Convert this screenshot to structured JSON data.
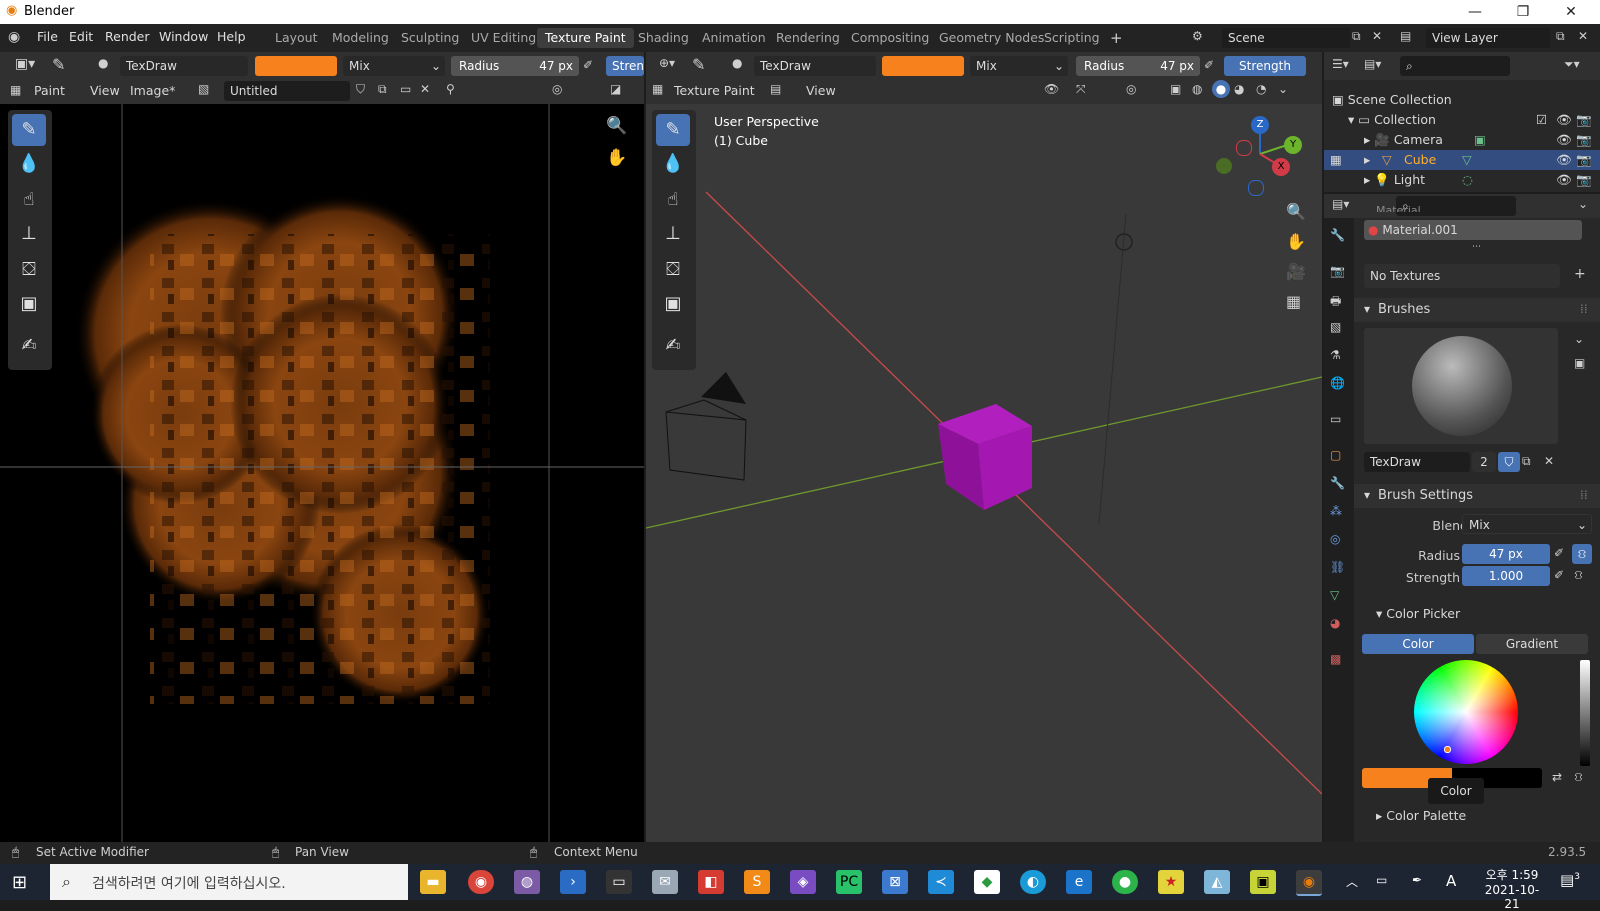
{
  "window": {
    "title": "Blender",
    "minimize": "—",
    "maximize": "❐",
    "close": "✕"
  },
  "menu": [
    "File",
    "Edit",
    "Render",
    "Window",
    "Help"
  ],
  "workspaces": [
    "Layout",
    "Modeling",
    "Sculpting",
    "UV Editing",
    "Texture Paint",
    "Shading",
    "Animation",
    "Rendering",
    "Compositing",
    "Geometry Nodes",
    "Scripting"
  ],
  "active_workspace": "Texture Paint",
  "scene": "Scene",
  "view_layer": "View Layer",
  "image_editor": {
    "brush_name": "TexDraw",
    "blend": "Mix",
    "radius_label": "Radius",
    "radius_value": "47 px",
    "strength_label": "Stren",
    "mode": "Paint",
    "view_menu": "View",
    "image_menu": "Image*",
    "image_name": "Untitled"
  },
  "viewport": {
    "brush_name": "TexDraw",
    "blend": "Mix",
    "radius_label": "Radius",
    "radius_value": "47 px",
    "strength_label": "Strength",
    "mode": "Texture Paint",
    "view_menu": "View",
    "overlay_title": "User Perspective",
    "overlay_object": "(1) Cube",
    "gizmo_z": "Z",
    "gizmo_y": "Y",
    "gizmo_x": "X"
  },
  "outliner": {
    "scene_collection": "Scene Collection",
    "collection": "Collection",
    "items": [
      "Camera",
      "Cube",
      "Light"
    ],
    "selected": "Cube"
  },
  "properties": {
    "material_cut": "Material",
    "material": "Material.001",
    "no_textures": "No Textures",
    "brushes_header": "Brushes",
    "brush_name": "TexDraw",
    "brush_users": "2",
    "brush_settings_header": "Brush Settings",
    "blend_label": "Blend",
    "blend_value": "Mix",
    "radius_label": "Radius",
    "radius_value": "47 px",
    "strength_label": "Strength",
    "strength_value": "1.000",
    "color_picker_header": "Color Picker",
    "tab_color": "Color",
    "tab_gradient": "Gradient",
    "tooltip": "Color",
    "color_palette": "Color Palette",
    "brush_color": "#f7811d"
  },
  "statusbar": {
    "left": "Set Active Modifier",
    "middle": "Pan View",
    "right": "Context Menu",
    "version": "2.93.5"
  },
  "taskbar": {
    "search_placeholder": "검색하려면 여기에 입력하십시오.",
    "time": "오후 1:59",
    "date": "2021-10-21",
    "ime": "A",
    "notifications": "3"
  }
}
